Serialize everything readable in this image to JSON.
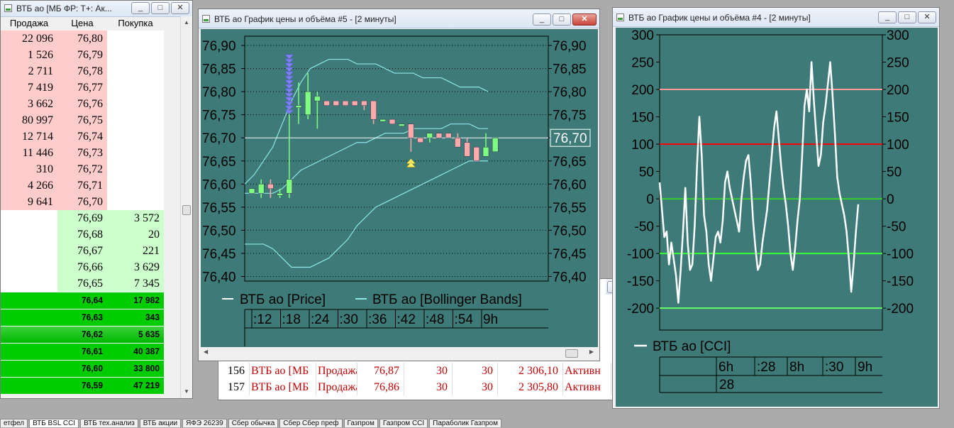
{
  "taskbar": {
    "tabs": [
      "етфел",
      "ВТБ BSL CCI",
      "ВТБ тех.анализ",
      "ВТБ акции",
      "ЯФЭ 26239",
      "Сбер обычка",
      "Сбер Сбер преф",
      "Газпром",
      "Газпром CCI",
      "Параболик Газпром"
    ],
    "active": 1
  },
  "orderbook": {
    "title": "ВТБ ао [МБ ФР: Т+: Ак...",
    "headers": [
      "Продажа",
      "Цена",
      "Покупка"
    ],
    "colors": {
      "sell": "#ffcccc",
      "buy": "#ccffcc",
      "strong_buy": "#00cc00"
    },
    "sell_rows": [
      [
        "22 096",
        "76,80"
      ],
      [
        "1 526",
        "76,79"
      ],
      [
        "2 711",
        "76,78"
      ],
      [
        "7 419",
        "76,77"
      ],
      [
        "3 662",
        "76,76"
      ],
      [
        "80 997",
        "76,75"
      ],
      [
        "12 714",
        "76,74"
      ],
      [
        "11 446",
        "76,73"
      ],
      [
        "310",
        "76,72"
      ],
      [
        "4 266",
        "76,71"
      ],
      [
        "9 641",
        "76,70"
      ]
    ],
    "buy_rows": [
      [
        "76,69",
        "3 572"
      ],
      [
        "76,68",
        "20"
      ],
      [
        "76,67",
        "221"
      ],
      [
        "76,66",
        "3 629"
      ],
      [
        "76,65",
        "7 345"
      ]
    ],
    "strong_rows": [
      [
        "76,64",
        "17 982"
      ],
      [
        "76,63",
        "343"
      ],
      [
        "76,62",
        "5 635"
      ],
      [
        "76,61",
        "40 387"
      ],
      [
        "76,60",
        "33 800"
      ],
      [
        "76,59",
        "47 219"
      ]
    ]
  },
  "trades": {
    "rows": [
      [
        "156",
        "ВТБ ао [МБ",
        "Продажа",
        "76,87",
        "30",
        "30",
        "2 306,10",
        "Активн"
      ],
      [
        "157",
        "ВТБ ао [МБ",
        "Продажа",
        "76,86",
        "30",
        "30",
        "2 305,80",
        "Активн"
      ]
    ]
  },
  "price_window": {
    "title": "ВТБ ао График цены и объёма #5 - [2 минуты]",
    "current_price": "76,70",
    "legend": [
      "ВТБ ао [Price]",
      "ВТБ ао [Bollinger Bands]"
    ],
    "time_labels": [
      ":12",
      ":18",
      ":24",
      ":30",
      ":36",
      ":42",
      ":48",
      ":54",
      "9h"
    ]
  },
  "cci_window": {
    "title": "ВТБ ао График цены и объёма #4 - [2 минуты]",
    "legend": "ВТБ ао [CCI]",
    "time_labels": [
      "6h",
      ":28",
      "8h",
      ":30",
      "9h"
    ],
    "bottom_value": "28"
  },
  "chart_data": [
    {
      "type": "candlestick",
      "y_ticks": [
        "76,90",
        "76,85",
        "76,80",
        "76,75",
        "76,70",
        "76,65",
        "76,60",
        "76,55",
        "76,50",
        "76,45",
        "76,40"
      ],
      "ylim": [
        76.39,
        76.92
      ],
      "hline": 76.7,
      "colors": {
        "background": "#3e7b78",
        "up": "#7fff7f",
        "down": "#ffaaaa",
        "bands": "#8ee6e6",
        "price_line": "#ffffff"
      },
      "candles": [
        {
          "o": 76.58,
          "c": 76.59,
          "h": 76.59,
          "l": 76.58
        },
        {
          "o": 76.58,
          "c": 76.6,
          "h": 76.61,
          "l": 76.57
        },
        {
          "o": 76.6,
          "c": 76.59,
          "h": 76.61,
          "l": 76.57
        },
        {
          "o": 76.58,
          "c": 76.58,
          "h": 76.59,
          "l": 76.57
        },
        {
          "o": 76.58,
          "c": 76.61,
          "h": 76.87,
          "l": 76.57
        },
        {
          "o": 76.77,
          "c": 76.77,
          "h": 76.82,
          "l": 76.73
        },
        {
          "o": 76.75,
          "c": 76.8,
          "h": 76.84,
          "l": 76.74
        },
        {
          "o": 76.78,
          "c": 76.79,
          "h": 76.8,
          "l": 76.72
        },
        {
          "o": 76.78,
          "c": 76.77,
          "h": 76.78,
          "l": 76.77
        },
        {
          "o": 76.78,
          "c": 76.77,
          "h": 76.78,
          "l": 76.77
        },
        {
          "o": 76.78,
          "c": 76.77,
          "h": 76.78,
          "l": 76.77
        },
        {
          "o": 76.78,
          "c": 76.77,
          "h": 76.78,
          "l": 76.77
        },
        {
          "o": 76.78,
          "c": 76.77,
          "h": 76.78,
          "l": 76.76
        },
        {
          "o": 76.78,
          "c": 76.74,
          "h": 76.78,
          "l": 76.73
        },
        {
          "o": 76.74,
          "c": 76.74,
          "h": 76.74,
          "l": 76.74
        },
        {
          "o": 76.74,
          "c": 76.73,
          "h": 76.74,
          "l": 76.73
        },
        {
          "o": 76.73,
          "c": 76.73,
          "h": 76.73,
          "l": 76.73
        },
        {
          "o": 76.73,
          "c": 76.7,
          "h": 76.73,
          "l": 76.67
        },
        {
          "o": 76.7,
          "c": 76.69,
          "h": 76.7,
          "l": 76.69
        },
        {
          "o": 76.7,
          "c": 76.71,
          "h": 76.71,
          "l": 76.69
        },
        {
          "o": 76.71,
          "c": 76.7,
          "h": 76.71,
          "l": 76.7
        },
        {
          "o": 76.71,
          "c": 76.7,
          "h": 76.71,
          "l": 76.7
        },
        {
          "o": 76.7,
          "c": 76.68,
          "h": 76.71,
          "l": 76.68
        },
        {
          "o": 76.69,
          "c": 76.66,
          "h": 76.7,
          "l": 76.66
        },
        {
          "o": 76.68,
          "c": 76.65,
          "h": 76.68,
          "l": 76.65
        },
        {
          "o": 76.66,
          "c": 76.68,
          "h": 76.71,
          "l": 76.66
        },
        {
          "o": 76.67,
          "c": 76.7,
          "h": 76.7,
          "l": 76.67
        }
      ],
      "bollinger": {
        "upper": [
          76.6,
          76.62,
          76.65,
          76.68,
          76.73,
          76.78,
          76.82,
          76.85,
          76.86,
          76.87,
          76.87,
          76.87,
          76.86,
          76.86,
          76.86,
          76.85,
          76.84,
          76.84,
          76.84,
          76.83,
          76.83,
          76.83,
          76.82,
          76.81,
          76.81,
          76.81,
          76.8
        ],
        "middle": [
          76.58,
          76.58,
          76.58,
          76.58,
          76.59,
          76.61,
          76.63,
          76.64,
          76.65,
          76.66,
          76.67,
          76.68,
          76.69,
          76.69,
          76.7,
          76.71,
          76.71,
          76.71,
          76.72,
          76.72,
          76.72,
          76.72,
          76.73,
          76.73,
          76.73,
          76.72,
          76.72
        ],
        "lower": [
          76.47,
          76.47,
          76.47,
          76.46,
          76.44,
          76.42,
          76.42,
          76.42,
          76.43,
          76.44,
          76.46,
          76.48,
          76.51,
          76.53,
          76.55,
          76.56,
          76.57,
          76.58,
          76.59,
          76.6,
          76.61,
          76.62,
          76.63,
          76.64,
          76.65,
          76.65,
          76.65
        ]
      },
      "markers": {
        "sell_arrows_index": 4,
        "buy_arrow_index": 17
      }
    },
    {
      "type": "line",
      "y_ticks": [
        "300",
        "250",
        "200",
        "150",
        "100",
        "50",
        "0",
        "-50",
        "-100",
        "-150",
        "-200"
      ],
      "ylim": [
        -240,
        300
      ],
      "levels": [
        {
          "value": 200,
          "color": "#ff9999"
        },
        {
          "value": 100,
          "color": "#ff0000"
        },
        {
          "value": 0,
          "color": "#33cc33"
        },
        {
          "value": -100,
          "color": "#33ff33"
        },
        {
          "value": -200,
          "color": "#66ff66"
        }
      ],
      "series": [
        {
          "color": "#ffffff",
          "values": [
            30,
            -20,
            -70,
            -60,
            -120,
            -80,
            -110,
            -140,
            -190,
            -130,
            -60,
            20,
            -80,
            -130,
            -120,
            -50,
            60,
            150,
            80,
            -30,
            -60,
            -120,
            -150,
            -110,
            -70,
            -60,
            -80,
            -40,
            30,
            50,
            20,
            0,
            -20,
            -40,
            -60,
            0,
            40,
            70,
            80,
            30,
            -40,
            -90,
            -130,
            -120,
            -80,
            -50,
            -20,
            30,
            80,
            130,
            160,
            110,
            60,
            20,
            -10,
            -50,
            -100,
            -130,
            -90,
            -40,
            0,
            80,
            170,
            200,
            160,
            250,
            180,
            120,
            60,
            80,
            140,
            170,
            210,
            250,
            190,
            120,
            40,
            10,
            -10,
            -30,
            -60,
            -110,
            -170,
            -120,
            -60,
            -10
          ]
        }
      ]
    }
  ]
}
